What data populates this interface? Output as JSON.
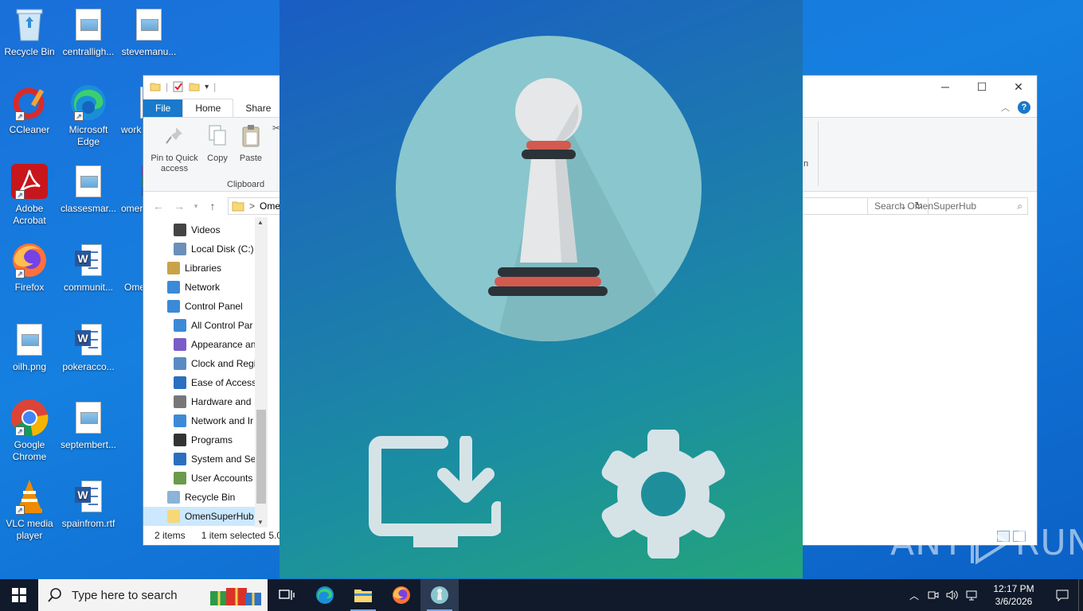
{
  "desktop": {
    "icons": [
      {
        "label": "Recycle Bin",
        "icon": "recycle-bin-icon"
      },
      {
        "label": "centralligh...",
        "icon": "image-file-icon"
      },
      {
        "label": "stevemanu...",
        "icon": "image-file-icon"
      },
      {
        "label": "CCleaner",
        "icon": "ccleaner-icon"
      },
      {
        "label": "Microsoft Edge",
        "icon": "edge-icon"
      },
      {
        "label": "work",
        "icon": "word-doc-icon"
      },
      {
        "label": "Adobe Acrobat",
        "icon": "acrobat-icon"
      },
      {
        "label": "classesmar...",
        "icon": "image-file-icon"
      },
      {
        "label": "omer",
        "icon": "winrar-icon"
      },
      {
        "label": "Firefox",
        "icon": "firefox-icon"
      },
      {
        "label": "communit...",
        "icon": "word-doc-icon"
      },
      {
        "label": "Ome",
        "icon": "folder-icon"
      },
      {
        "label": "oilh.png",
        "icon": "image-file-icon"
      },
      {
        "label": "pokeracco...",
        "icon": "word-doc-icon"
      },
      {
        "label": "Google Chrome",
        "icon": "chrome-icon"
      },
      {
        "label": "septembert...",
        "icon": "image-file-icon"
      },
      {
        "label": "VLC media player",
        "icon": "vlc-icon"
      },
      {
        "label": "spainfrom.rtf",
        "icon": "word-doc-icon"
      }
    ]
  },
  "explorer": {
    "tabs": {
      "file": "File",
      "home": "Home",
      "share": "Share"
    },
    "ribbon": {
      "pin": "Pin to Quick access",
      "copy": "Copy",
      "paste": "Paste",
      "clipboard_group": "Clipboard",
      "partial_label": "n"
    },
    "address": {
      "path": "Omen",
      "separator": ">"
    },
    "search": {
      "placeholder": "Search OmenSuperHub"
    },
    "nav_items": [
      {
        "label": "Videos",
        "indent": 2,
        "icon": "videos-icon"
      },
      {
        "label": "Local Disk (C:)",
        "indent": 2,
        "icon": "drive-icon"
      },
      {
        "label": "Libraries",
        "indent": 1,
        "icon": "libraries-icon"
      },
      {
        "label": "Network",
        "indent": 1,
        "icon": "network-icon"
      },
      {
        "label": "Control Panel",
        "indent": 1,
        "icon": "control-panel-icon"
      },
      {
        "label": "All Control Par",
        "indent": 2,
        "icon": "control-panel-icon"
      },
      {
        "label": "Appearance an",
        "indent": 2,
        "icon": "appearance-icon"
      },
      {
        "label": "Clock and Regi",
        "indent": 2,
        "icon": "clock-icon"
      },
      {
        "label": "Ease of Access",
        "indent": 2,
        "icon": "ease-of-access-icon"
      },
      {
        "label": "Hardware and",
        "indent": 2,
        "icon": "hardware-icon"
      },
      {
        "label": "Network and Ir",
        "indent": 2,
        "icon": "network-internet-icon"
      },
      {
        "label": "Programs",
        "indent": 2,
        "icon": "programs-icon"
      },
      {
        "label": "System and Se",
        "indent": 2,
        "icon": "system-security-icon"
      },
      {
        "label": "User Accounts",
        "indent": 2,
        "icon": "user-accounts-icon"
      },
      {
        "label": "Recycle Bin",
        "indent": 1,
        "icon": "recycle-bin-icon"
      },
      {
        "label": "OmenSuperHub",
        "indent": 1,
        "icon": "folder-icon",
        "selected": true
      }
    ],
    "status": {
      "items": "2 items",
      "selected": "1 item selected",
      "size": "5.0"
    }
  },
  "watermark": {
    "text_left": "ANY",
    "text_right": "RUN"
  },
  "taskbar": {
    "search_placeholder": "Type here to search",
    "clock_time": "12:17 PM",
    "clock_date": "3/6/2026"
  },
  "colors": {
    "accent": "#1979ca",
    "pawn_red": "#d35a4f",
    "pawn_dark": "#2c3338",
    "circle": "#8ac6cd"
  }
}
